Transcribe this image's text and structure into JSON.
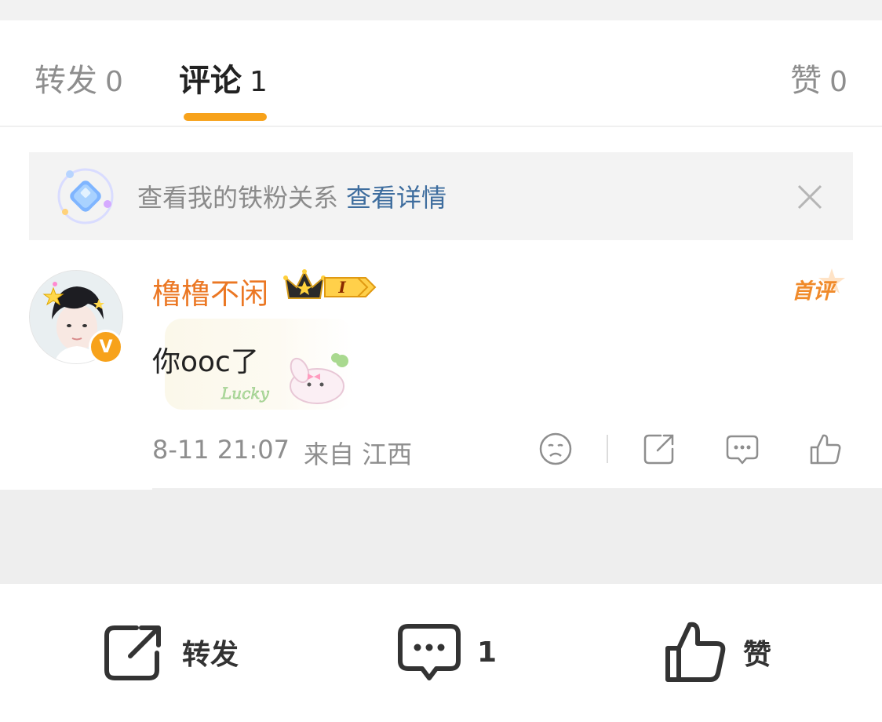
{
  "tabs": [
    {
      "label": "转发",
      "count": "0"
    },
    {
      "label": "评论",
      "count": "1"
    },
    {
      "label": "赞",
      "count": "0"
    }
  ],
  "active_tab": "评论",
  "fan_banner": {
    "text": "查看我的铁粉关系",
    "link": "查看详情",
    "icon": "diamond-icon",
    "close_icon": "close-icon"
  },
  "comment": {
    "username": "橹橹不闲",
    "level_badge": "I",
    "first_comment_badge": "首评",
    "text": "你ooc了",
    "sticker_text": "Lucky",
    "time": "8-11 21:07",
    "location": "来自 江西",
    "verified_badge": "V"
  },
  "bottom_bar": {
    "repost_label": "转发",
    "comment_count": "1",
    "like_label": "赞"
  },
  "colors": {
    "accent": "#f7a21b",
    "username": "#eb7723",
    "link": "#3e6d9e"
  }
}
